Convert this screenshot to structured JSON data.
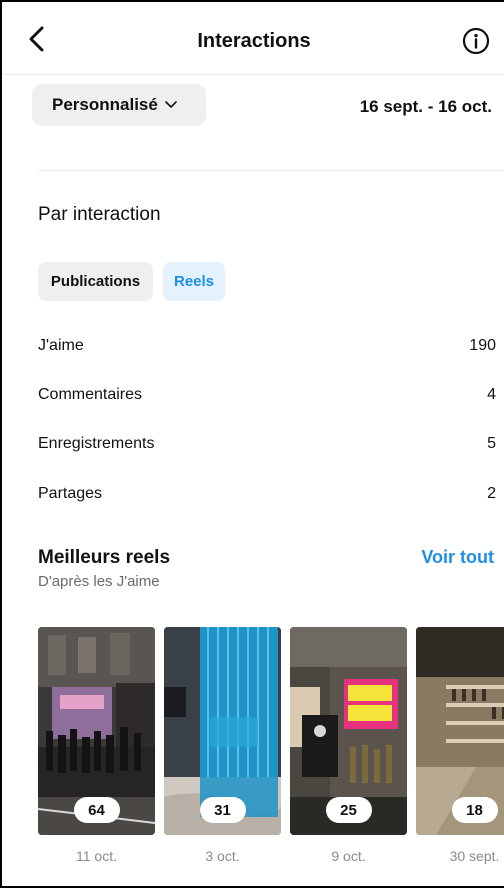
{
  "header": {
    "title": "Interactions",
    "back_icon": "chevron-left-icon",
    "info_icon": "info-icon"
  },
  "filters": {
    "period_label": "Personnalisé",
    "date_range": "16 sept. - 16 oct."
  },
  "interactions": {
    "section_title": "Par interaction",
    "tabs": [
      {
        "label": "Publications",
        "selected": false
      },
      {
        "label": "Reels",
        "selected": true
      }
    ],
    "metrics": [
      {
        "label": "J'aime",
        "value": "190"
      },
      {
        "label": "Commentaires",
        "value": "4"
      },
      {
        "label": "Enregistrements",
        "value": "5"
      },
      {
        "label": "Partages",
        "value": "2"
      }
    ]
  },
  "best_reels": {
    "title": "Meilleurs reels",
    "subtitle": "D'après les J'aime",
    "see_all": "Voir tout",
    "items": [
      {
        "count": "64",
        "date": "11 oct."
      },
      {
        "count": "31",
        "date": "3 oct."
      },
      {
        "count": "25",
        "date": "9 oct."
      },
      {
        "count": "18",
        "date": "30 sept."
      }
    ]
  },
  "colors": {
    "accent": "#1f8ee6",
    "tab_selected_bg": "#e3f2fd",
    "chip_bg": "#efefef"
  }
}
